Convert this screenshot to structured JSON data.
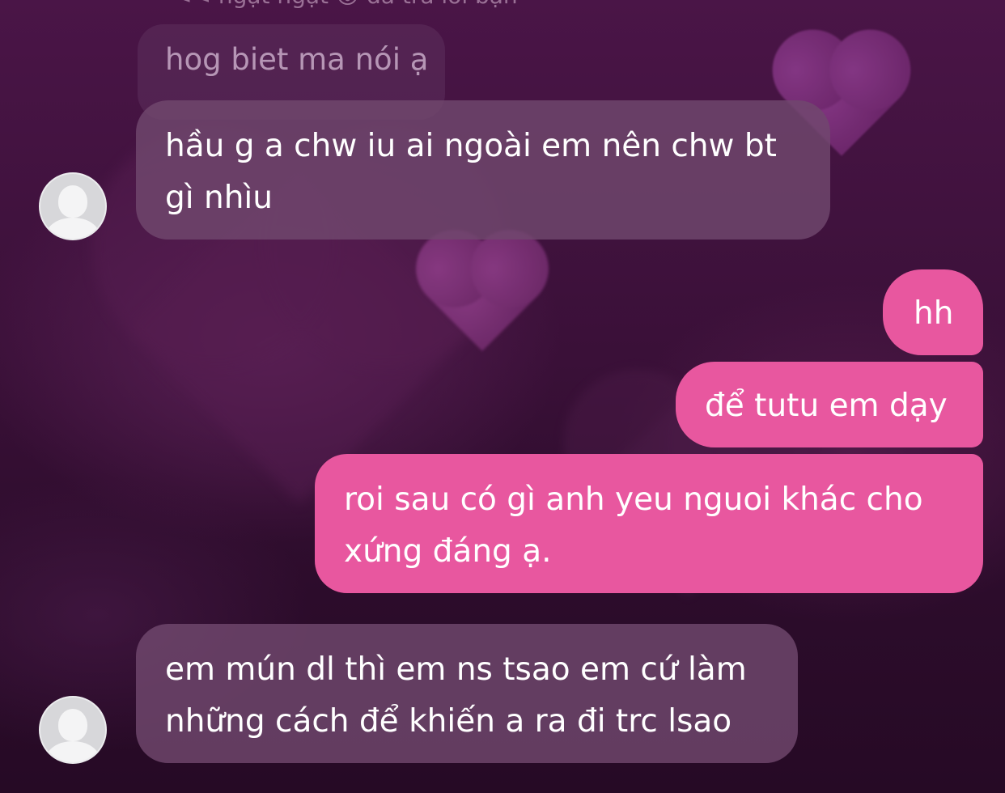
{
  "chat": {
    "reply_preview": "<< ngạt ngạt 😮 đã trả lời bạn",
    "quoted_message": "hog biet ma nói ạ",
    "messages": [
      {
        "side": "received",
        "lines": [
          "hầu g a chw iu ai ngoài em nên chw bt",
          "gì nhìu"
        ]
      },
      {
        "side": "sent",
        "lines": [
          "hh"
        ]
      },
      {
        "side": "sent",
        "lines": [
          "để tutu em dạy"
        ]
      },
      {
        "side": "sent",
        "lines": [
          "roi sau có gì anh yeu nguoi khác cho",
          "xứng đáng ạ."
        ]
      },
      {
        "side": "received",
        "lines": [
          "em mún dl thì em ns tsao em cứ làm",
          "những cách để khiến a ra đi trc lsao"
        ]
      }
    ]
  },
  "colors": {
    "sent_bubble": "#e8579f",
    "received_bubble": "#70486e",
    "background": "#3a1038"
  },
  "icons": {
    "avatar": "default-user-avatar-icon",
    "background_decoration": "heart-icon"
  }
}
